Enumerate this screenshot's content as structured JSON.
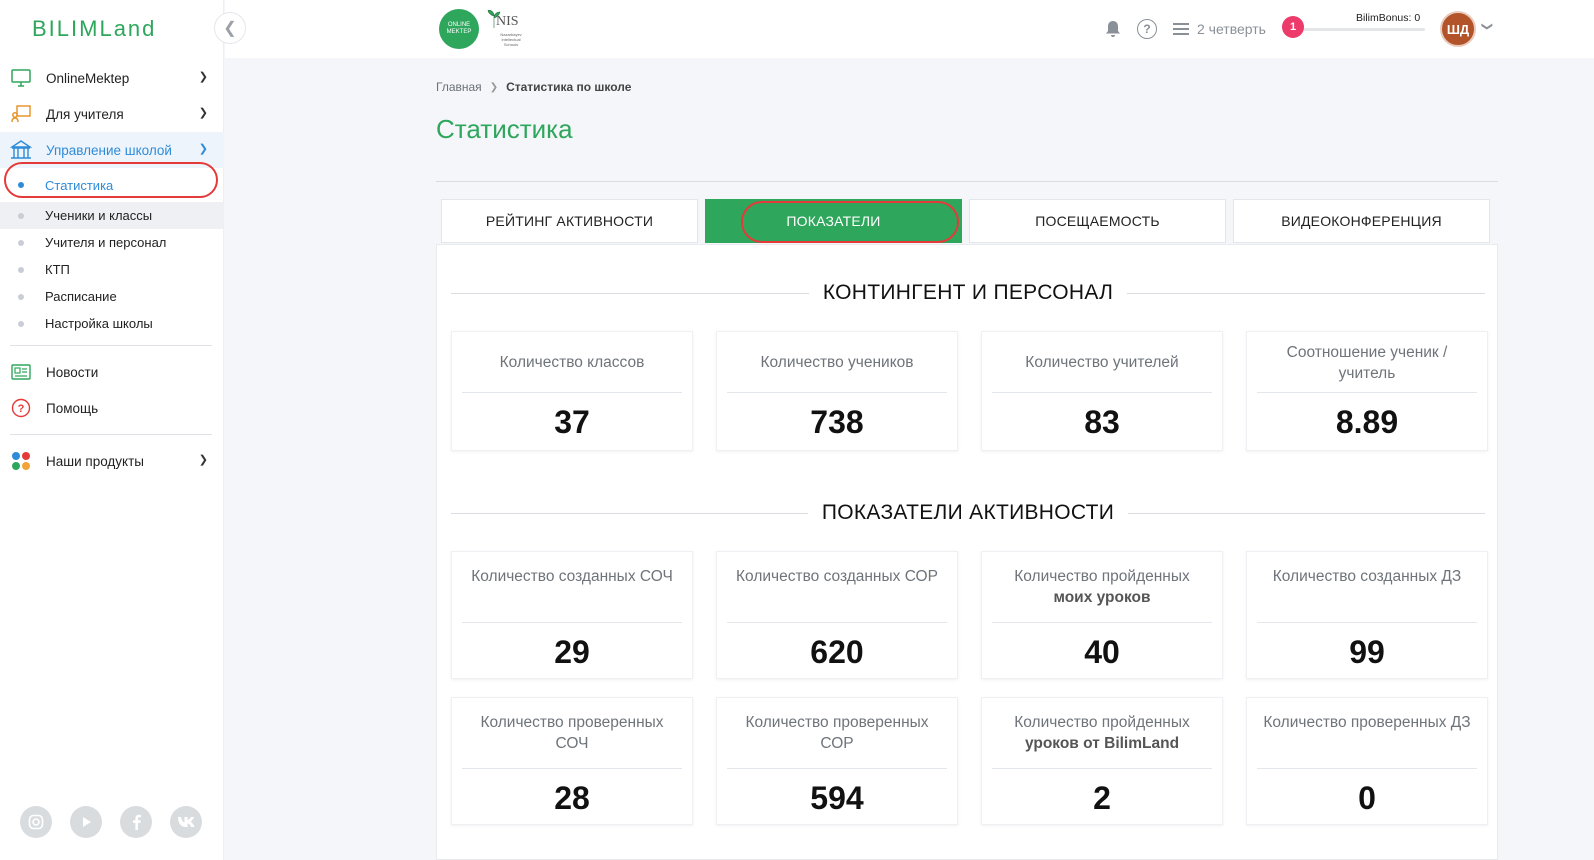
{
  "app": {
    "logo_text": "BILIMLand",
    "collapse_icon": "chevron-left-icon"
  },
  "sidebar": {
    "items": [
      {
        "label": "OnlineMektep",
        "icon": "monitor-icon"
      },
      {
        "label": "Для учителя",
        "icon": "teacher-icon"
      },
      {
        "label": "Управление школой",
        "icon": "school-icon"
      }
    ],
    "school_sub": [
      {
        "label": "Статистика"
      },
      {
        "label": "Ученики и классы"
      },
      {
        "label": "Учителя и персонал"
      },
      {
        "label": "КТП"
      },
      {
        "label": "Расписание"
      },
      {
        "label": "Настройка школы"
      }
    ],
    "news": "Новости",
    "help": "Помощь",
    "products": "Наши продукты",
    "socials": [
      "instagram-icon",
      "youtube-icon",
      "facebook-icon",
      "vk-icon"
    ]
  },
  "topbar": {
    "online_mektep_logo": "ONLINE MEKTEP",
    "nis_logo": "NIS",
    "nis_subtitle": "Nazarbayev Intellectual Schools",
    "quarter": "2 четверть",
    "notifications_count": "1",
    "bonus_label": "BilimBonus: 0",
    "bonus_fraction": 0.0,
    "avatar_initials": "ШД"
  },
  "breadcrumb": {
    "home": "Главная",
    "current": "Статистика по школе"
  },
  "page": {
    "title": "Статистика"
  },
  "tabs": [
    {
      "label": "РЕЙТИНГ АКТИВНОСТИ"
    },
    {
      "label": "ПОКАЗАТЕЛИ"
    },
    {
      "label": "ПОСЕЩАЕМОСТЬ"
    },
    {
      "label": "ВИДЕОКОНФЕРЕНЦИЯ"
    }
  ],
  "sections": {
    "contingent": {
      "title": "КОНТИНГЕНТ И ПЕРСОНАЛ",
      "cards": [
        {
          "label": "Количество классов",
          "value": "37"
        },
        {
          "label": "Количество учеников",
          "value": "738"
        },
        {
          "label": "Количество учителей",
          "value": "83"
        },
        {
          "label": "Соотношение ученик / учитель",
          "value": "8.89"
        }
      ]
    },
    "activity": {
      "title": "ПОКАЗАТЕЛИ АКТИВНОСТИ",
      "cards": [
        {
          "label": "Количество созданных СОЧ",
          "value": "29"
        },
        {
          "label": "Количество созданных СОР",
          "value": "620"
        },
        {
          "label_a": "Количество пройденных",
          "label_b": "моих уроков",
          "value": "40"
        },
        {
          "label": "Количество созданных ДЗ",
          "value": "99"
        },
        {
          "label": "Количество проверенных СОЧ",
          "value": "28"
        },
        {
          "label": "Количество проверенных СОР",
          "value": "594"
        },
        {
          "label_a": "Количество пройденных",
          "label_b": "уроков от BilimLand",
          "value": "2"
        },
        {
          "label": "Количество проверенных ДЗ",
          "value": "0"
        }
      ]
    }
  }
}
